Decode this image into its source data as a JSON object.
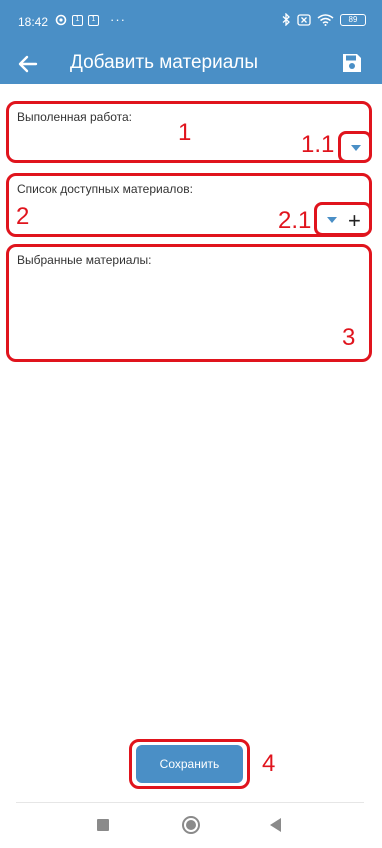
{
  "status_bar": {
    "time": "18:42",
    "square_icon_1": "1",
    "square_icon_2": "1",
    "more": "···",
    "battery": "89"
  },
  "app_bar": {
    "title": "Добавить материалы"
  },
  "fields": {
    "completed_work": {
      "label": "Выполенная работа:",
      "annotation": "1",
      "dropdown_annotation": "1.1"
    },
    "available_materials": {
      "label": "Список доступных материалов:",
      "annotation": "2",
      "dropdown_annotation": "2.1",
      "add_symbol": "+"
    },
    "selected_materials": {
      "label": "Выбранные материалы:",
      "annotation": "3"
    }
  },
  "save_button": {
    "label": "Сохранить",
    "annotation": "4"
  },
  "colors": {
    "primary": "#4a8fc6",
    "annotation_red": "#e0141d"
  },
  "icons": [
    "back-arrow-icon",
    "save-disk-icon",
    "dropdown-triangle-icon",
    "plus-icon",
    "bluetooth-icon",
    "wifi-icon",
    "battery-icon",
    "stop-square-icon",
    "home-circle-icon",
    "back-triangle-icon"
  ]
}
